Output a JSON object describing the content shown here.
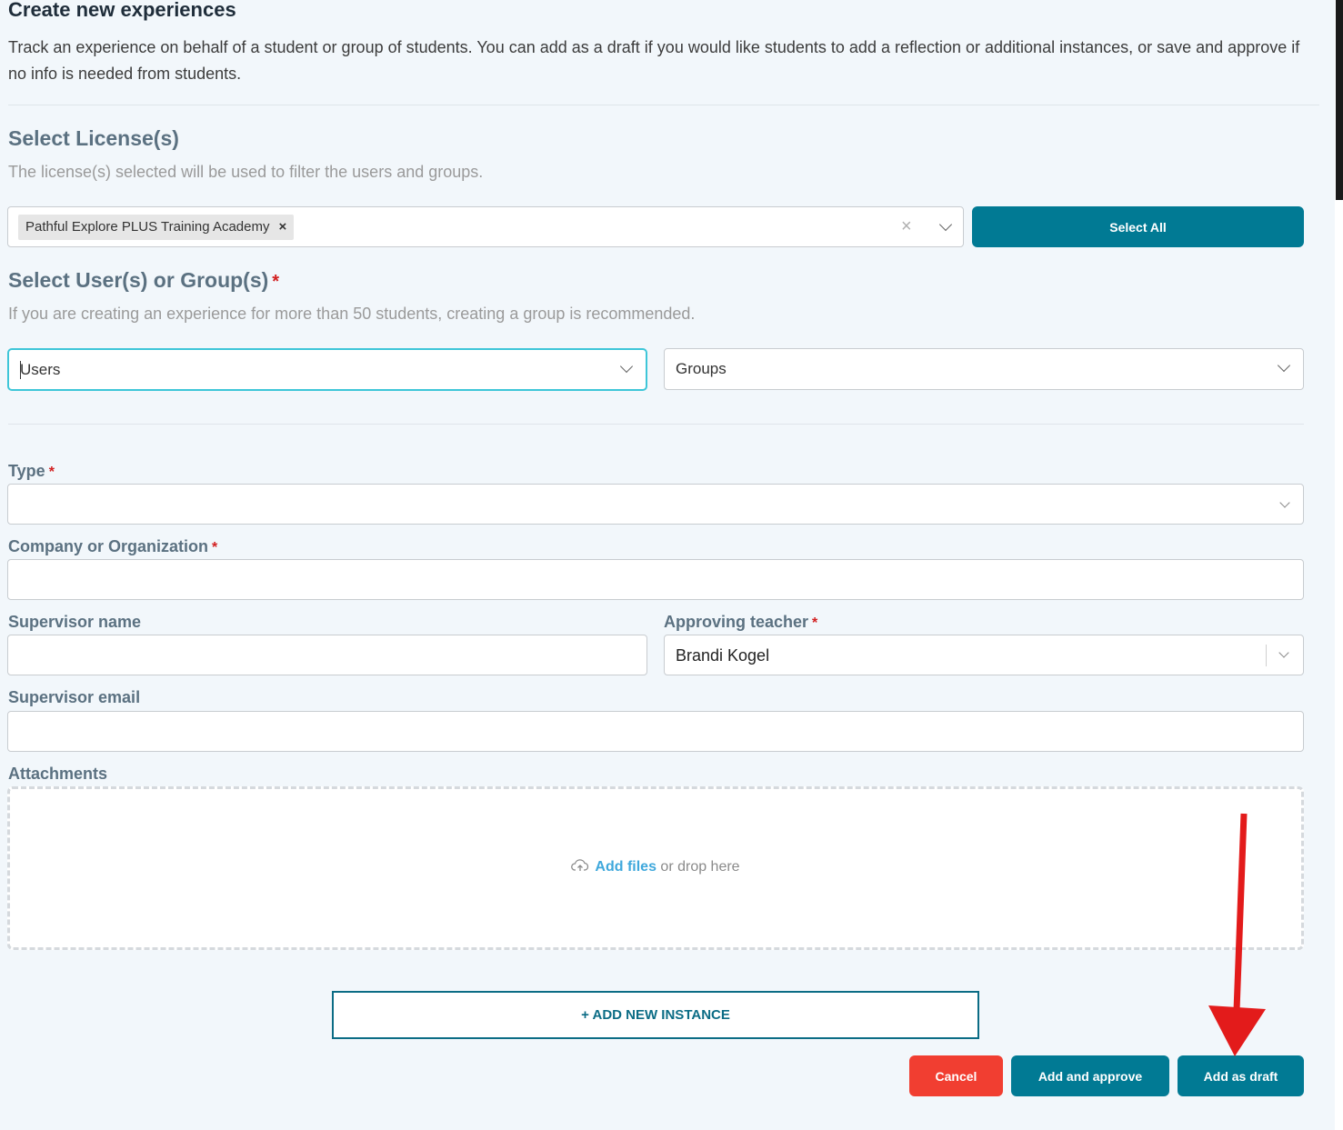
{
  "page": {
    "title": "Create new experiences",
    "intro": "Track an experience on behalf of a student or group of students. You can add as a draft if you would like students to add a reflection or additional instances, or save and approve if no info is needed from students."
  },
  "license": {
    "title": "Select License(s)",
    "help": "The license(s) selected will be used to filter the users and groups.",
    "chip": "Pathful Explore PLUS Training Academy",
    "chip_remove": "×",
    "clear": "×",
    "select_all": "Select All"
  },
  "users_groups": {
    "title": "Select User(s) or Group(s)",
    "required": "*",
    "help": "If you are creating an experience for more than 50 students, creating a group is recommended.",
    "users_placeholder": "Users",
    "groups_placeholder": "Groups"
  },
  "form": {
    "type_label": "Type",
    "company_label": "Company or Organization",
    "supervisor_name_label": "Supervisor name",
    "approving_teacher_label": "Approving teacher",
    "approving_teacher_value": "Brandi Kogel",
    "supervisor_email_label": "Supervisor email",
    "attachments_label": "Attachments",
    "required": "*",
    "add_files": "Add files",
    "drop_here": " or drop here"
  },
  "actions": {
    "add_instance": "+ ADD NEW INSTANCE",
    "cancel": "Cancel",
    "add_approve": "Add and approve",
    "add_draft": "Add as draft"
  },
  "colors": {
    "teal": "#017a94",
    "red": "#f13e31",
    "annotation_arrow": "#e31b1b"
  }
}
